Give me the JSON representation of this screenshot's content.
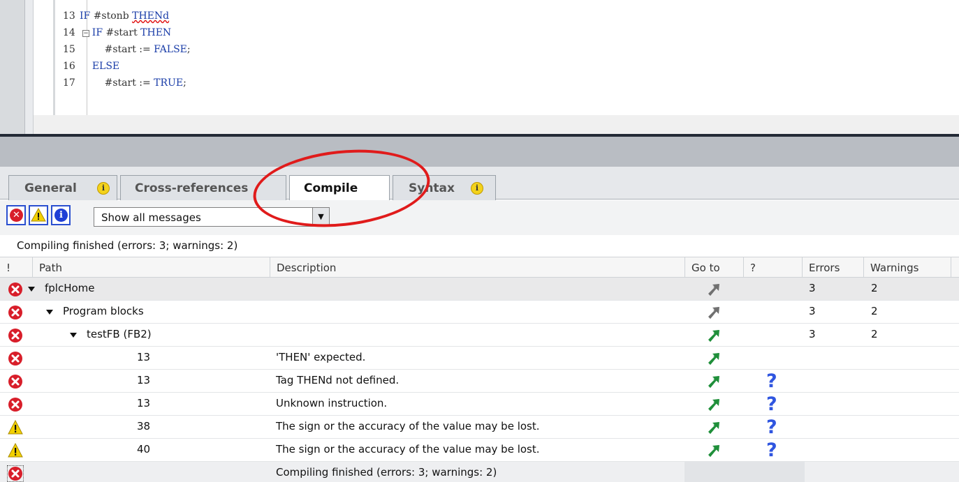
{
  "code": {
    "lines": [
      {
        "num": "13",
        "pre": "IF ",
        "tok": "#stonb ",
        "err": "THENd",
        "post": ""
      },
      {
        "num": "14",
        "pre": "    IF ",
        "tok": "#start ",
        "kw": "THEN",
        "post": ""
      },
      {
        "num": "15",
        "pre": "        ",
        "tok": "#start := ",
        "kw": "FALSE",
        "post": ";"
      },
      {
        "num": "16",
        "pre": "    ",
        "kw": "ELSE",
        "post": ""
      },
      {
        "num": "17",
        "pre": "        ",
        "tok": "#start := ",
        "kw": "TRUE",
        "post": ";"
      }
    ]
  },
  "tabs": [
    {
      "label": "General",
      "info": true,
      "active": false
    },
    {
      "label": "Cross-references",
      "info": false,
      "active": false
    },
    {
      "label": "Compile",
      "info": false,
      "active": true
    },
    {
      "label": "Syntax",
      "info": true,
      "active": false
    }
  ],
  "toolbar": {
    "filter_value": "Show all messages"
  },
  "status_text": "Compiling finished (errors: 3; warnings: 2)",
  "columns": [
    "!",
    "Path",
    "Description",
    "Go to",
    "?",
    "Errors",
    "Warnings"
  ],
  "rows": [
    {
      "type": "error",
      "indent": 0,
      "expand": true,
      "path": "fplcHome",
      "description": "",
      "goto": "gray",
      "help": false,
      "errors": "3",
      "warnings": "2"
    },
    {
      "type": "error",
      "indent": 1,
      "expand": true,
      "path": "Program blocks",
      "description": "",
      "goto": "gray",
      "help": false,
      "errors": "3",
      "warnings": "2"
    },
    {
      "type": "error",
      "indent": 2,
      "expand": true,
      "path": "testFB (FB2)",
      "description": "",
      "goto": "green",
      "help": false,
      "errors": "3",
      "warnings": "2"
    },
    {
      "type": "error",
      "indent": 3,
      "expand": false,
      "path": "13",
      "description": "'THEN' expected.",
      "goto": "green",
      "help": false,
      "errors": "",
      "warnings": ""
    },
    {
      "type": "error",
      "indent": 3,
      "expand": false,
      "path": "13",
      "description": "Tag THENd not defined.",
      "goto": "green",
      "help": true,
      "errors": "",
      "warnings": ""
    },
    {
      "type": "error",
      "indent": 3,
      "expand": false,
      "path": "13",
      "description": "Unknown instruction.",
      "goto": "green",
      "help": true,
      "errors": "",
      "warnings": ""
    },
    {
      "type": "warning",
      "indent": 3,
      "expand": false,
      "path": "38",
      "description": "The sign or the accuracy of the value may be lost.",
      "goto": "green",
      "help": true,
      "errors": "",
      "warnings": ""
    },
    {
      "type": "warning",
      "indent": 3,
      "expand": false,
      "path": "40",
      "description": "The sign or the accuracy of the value may be lost.",
      "goto": "green",
      "help": true,
      "errors": "",
      "warnings": ""
    },
    {
      "type": "error",
      "indent": 0,
      "expand": false,
      "path": "",
      "description": "Compiling finished (errors: 3; warnings: 2)",
      "goto": "none",
      "help": false,
      "errors": "",
      "warnings": ""
    }
  ],
  "colors": {
    "error": "#d81e2a",
    "warning": "#f2d000",
    "info": "#1f3fd6",
    "goto_green": "#1f8f3a",
    "goto_gray": "#707070",
    "help": "#2f55e0",
    "annotation": "#e01b1b"
  },
  "icons": {
    "error": "error-icon",
    "warning": "warning-icon",
    "info": "info-icon",
    "goto": "goto-arrow-icon",
    "help": "help-icon",
    "expand": "expand-triangle-icon"
  }
}
